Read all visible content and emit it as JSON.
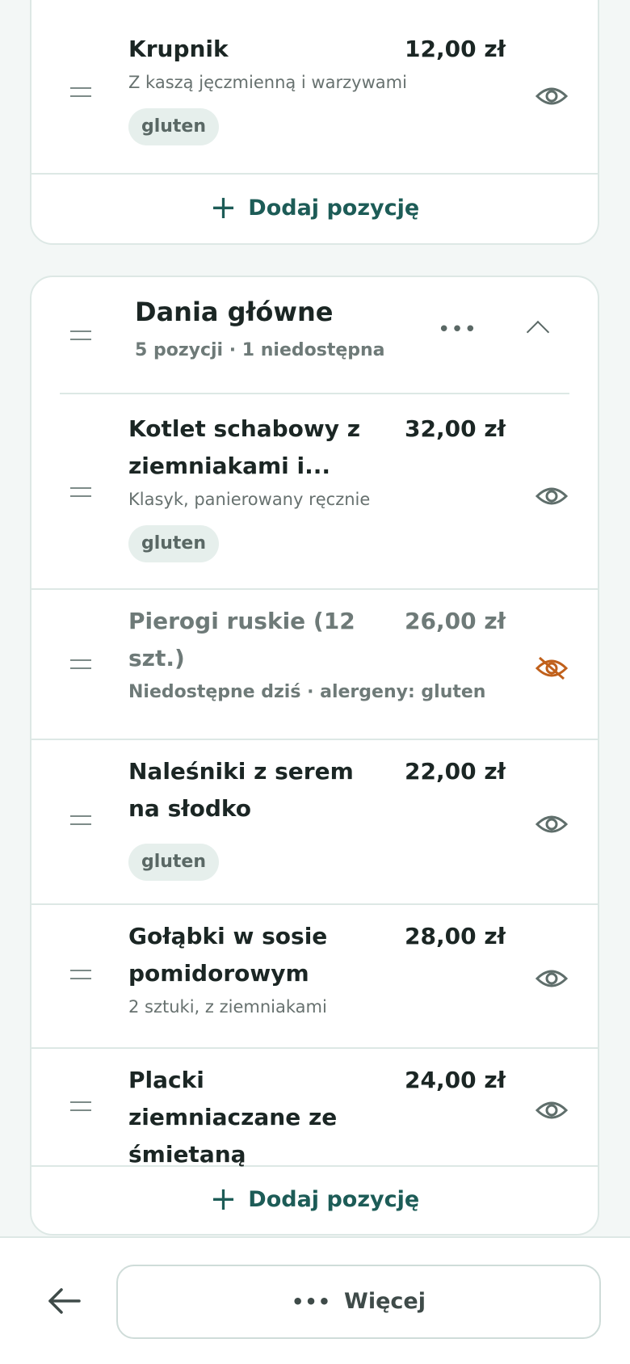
{
  "top_section": {
    "items": [
      {
        "name": "Krupnik",
        "price": "12,00 zł",
        "desc": "Z kaszą jęczmienną i warzywami",
        "tag": "gluten",
        "visibility": "visible"
      }
    ],
    "add_label": "Dodaj pozycję"
  },
  "main_section": {
    "title": "Dania główne",
    "subtitle": "5 pozycji · 1 niedostępna",
    "items": [
      {
        "name": "Kotlet schabowy z ziemniakami i...",
        "price": "32,00 zł",
        "desc": "Klasyk, panierowany ręcznie",
        "tag": "gluten",
        "visibility": "visible"
      },
      {
        "name": "Pierogi ruskie (12 szt.)",
        "price": "26,00 zł",
        "desc": "Niedostępne dziś · alergeny: gluten",
        "visibility": "hidden"
      },
      {
        "name": "Naleśniki z serem na słodko",
        "price": "22,00 zł",
        "tag": "gluten",
        "visibility": "visible"
      },
      {
        "name": "Gołąbki w sosie pomidorowym",
        "price": "28,00 zł",
        "desc": "2 sztuki, z ziemniakami",
        "visibility": "visible"
      },
      {
        "name": "Placki ziemniaczane ze śmietaną",
        "price": "24,00 zł",
        "visibility": "visible"
      }
    ],
    "add_label": "Dodaj pozycję"
  },
  "bottom_bar": {
    "more_label": "Więcej"
  },
  "icons": {
    "drag": "drag-handle-icon",
    "visible": "eye-icon",
    "hidden": "eye-off-icon",
    "more": "more-horizontal-icon",
    "collapse": "chevron-up-icon",
    "back": "arrow-left-icon",
    "add": "plus-icon"
  },
  "colors": {
    "accent": "#1d5c57",
    "hidden_icon": "#c0601b",
    "icon": "#5f6e6b",
    "tag_bg": "#e6efec"
  }
}
